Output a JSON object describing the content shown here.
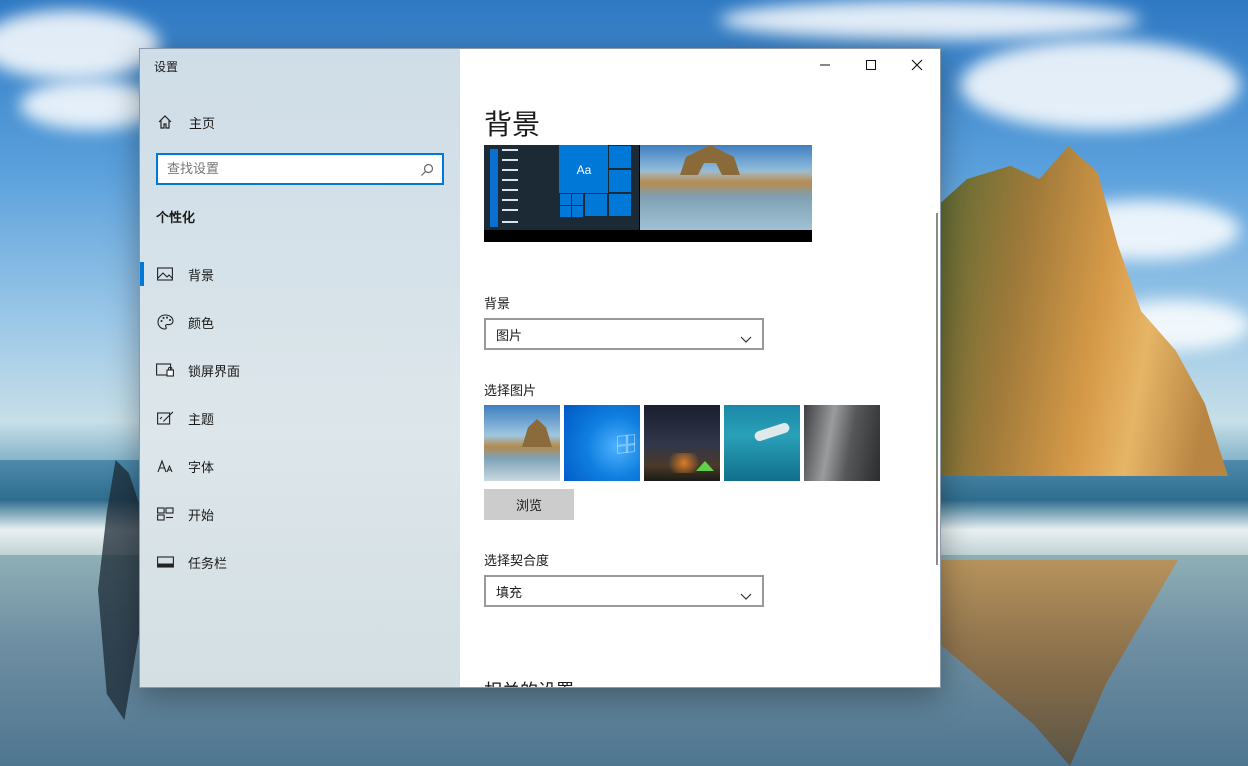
{
  "window": {
    "app_title": "设置",
    "controls": {
      "minimize": "minimize",
      "maximize": "maximize",
      "close": "close"
    }
  },
  "sidebar": {
    "home_label": "主页",
    "search_placeholder": "查找设置",
    "section_heading": "个性化",
    "items": [
      {
        "label": "背景",
        "icon": "picture-icon",
        "active": true
      },
      {
        "label": "颜色",
        "icon": "palette-icon",
        "active": false
      },
      {
        "label": "锁屏界面",
        "icon": "lock-screen-icon",
        "active": false
      },
      {
        "label": "主题",
        "icon": "theme-icon",
        "active": false
      },
      {
        "label": "字体",
        "icon": "font-icon",
        "active": false
      },
      {
        "label": "开始",
        "icon": "start-icon",
        "active": false
      },
      {
        "label": "任务栏",
        "icon": "taskbar-icon",
        "active": false
      }
    ]
  },
  "content": {
    "page_title": "背景",
    "preview_tile_text": "Aa",
    "background_label": "背景",
    "background_value": "图片",
    "choose_picture_label": "选择图片",
    "browse_label": "浏览",
    "fit_label": "选择契合度",
    "fit_value": "填充",
    "related_heading": "相关的设置"
  },
  "colors": {
    "accent": "#0078d7",
    "sidebar_bg": "#d6e2e9",
    "content_bg": "#ffffff",
    "button_bg": "#cccccc"
  }
}
